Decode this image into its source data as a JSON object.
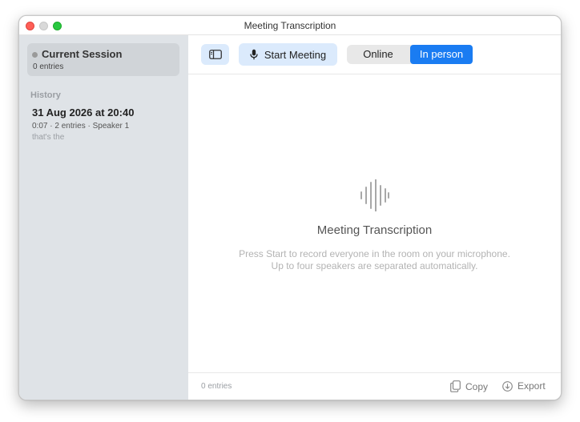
{
  "window": {
    "title": "Meeting Transcription"
  },
  "sidebar": {
    "current_session": {
      "title": "Current Session",
      "subtitle": "0 entries"
    },
    "history_label": "History",
    "history": [
      {
        "title": "31 Aug 2026 at 20:40",
        "meta": "0:07 · 2 entries · Speaker 1",
        "preview": "that's the"
      }
    ]
  },
  "toolbar": {
    "start_label": "Start Meeting",
    "mode_options": [
      "Online",
      "In person"
    ],
    "selected_mode": "In person"
  },
  "empty_state": {
    "title": "Meeting Transcription",
    "line1": "Press Start to record everyone in the room on your microphone.",
    "line2": "Up to four speakers are separated automatically."
  },
  "footer": {
    "count": "0 entries",
    "copy_label": "Copy",
    "export_label": "Export"
  },
  "colors": {
    "accent": "#1a7cf2",
    "accent_light": "#dbeafc",
    "sidebar_bg": "#dfe3e7"
  },
  "icons": [
    "sidebar-toggle-icon",
    "microphone-icon",
    "waveform-icon",
    "copy-icon",
    "export-icon"
  ]
}
